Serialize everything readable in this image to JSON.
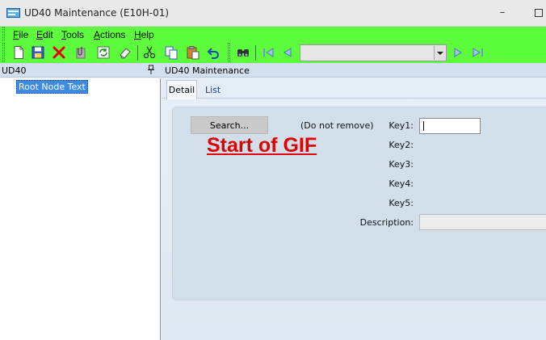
{
  "window": {
    "title": "UD40 Maintenance (E10H-01)",
    "minimize_glyph": "–"
  },
  "menu": [
    {
      "underline": "F",
      "rest": "ile"
    },
    {
      "underline": "E",
      "rest": "dit"
    },
    {
      "underline": "T",
      "rest": "ools"
    },
    {
      "underline": "A",
      "rest": "ctions"
    },
    {
      "underline": "H",
      "rest": "elp"
    }
  ],
  "toolbar": {
    "icons": [
      "new-icon",
      "save-icon",
      "delete-icon",
      "attach-icon",
      "refresh-icon",
      "clear-icon",
      "cut-icon",
      "copy-icon",
      "paste-icon",
      "undo-icon",
      "find-icon",
      "first-record-icon",
      "previous-record-icon",
      "navigation-combo",
      "next-record-icon",
      "last-record-icon"
    ],
    "combo_value": ""
  },
  "tree": {
    "title": "UD40",
    "pin_glyph": "📌",
    "root_node": "Root Node Text"
  },
  "main": {
    "title": "UD40 Maintenance",
    "tabs": [
      "Detail",
      "List"
    ],
    "search_label": "Search...",
    "do_not_remove": "(Do not remove)",
    "fields": [
      "Key1:",
      "Key2:",
      "Key3:",
      "Key4:",
      "Key5:",
      "Description:"
    ],
    "key1_value": "",
    "description_value": "",
    "banner_text": "Start of GIF"
  },
  "colors": {
    "toolbar_bg": "#5dfc3c",
    "banner_red": "#e00000",
    "selection_blue": "#3e8ae0"
  }
}
